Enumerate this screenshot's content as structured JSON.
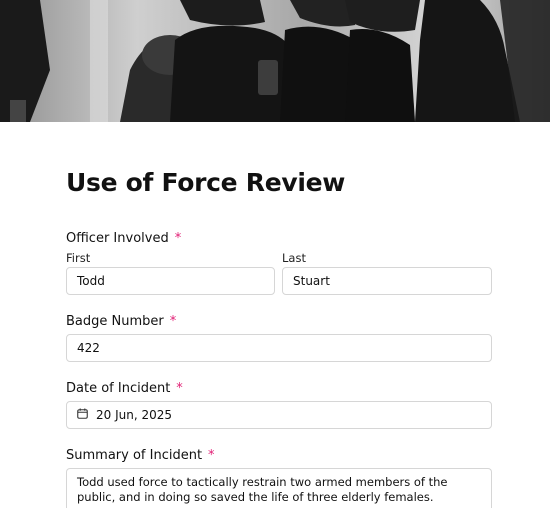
{
  "form": {
    "title": "Use of Force Review",
    "required_marker": "*",
    "officer": {
      "label": "Officer Involved",
      "first_label": "First",
      "first_value": "Todd",
      "last_label": "Last",
      "last_value": "Stuart"
    },
    "badge": {
      "label": "Badge Number",
      "value": "422"
    },
    "date": {
      "label": "Date of Incident",
      "value": "20 Jun, 2025",
      "icon": "calendar-icon"
    },
    "summary": {
      "label": "Summary of Incident",
      "value": "Todd used force to tactically restrain two armed members of the public, and in doing so saved the life of three elderly females."
    }
  },
  "colors": {
    "required": "#e11d74",
    "border": "#d6d6d6"
  }
}
